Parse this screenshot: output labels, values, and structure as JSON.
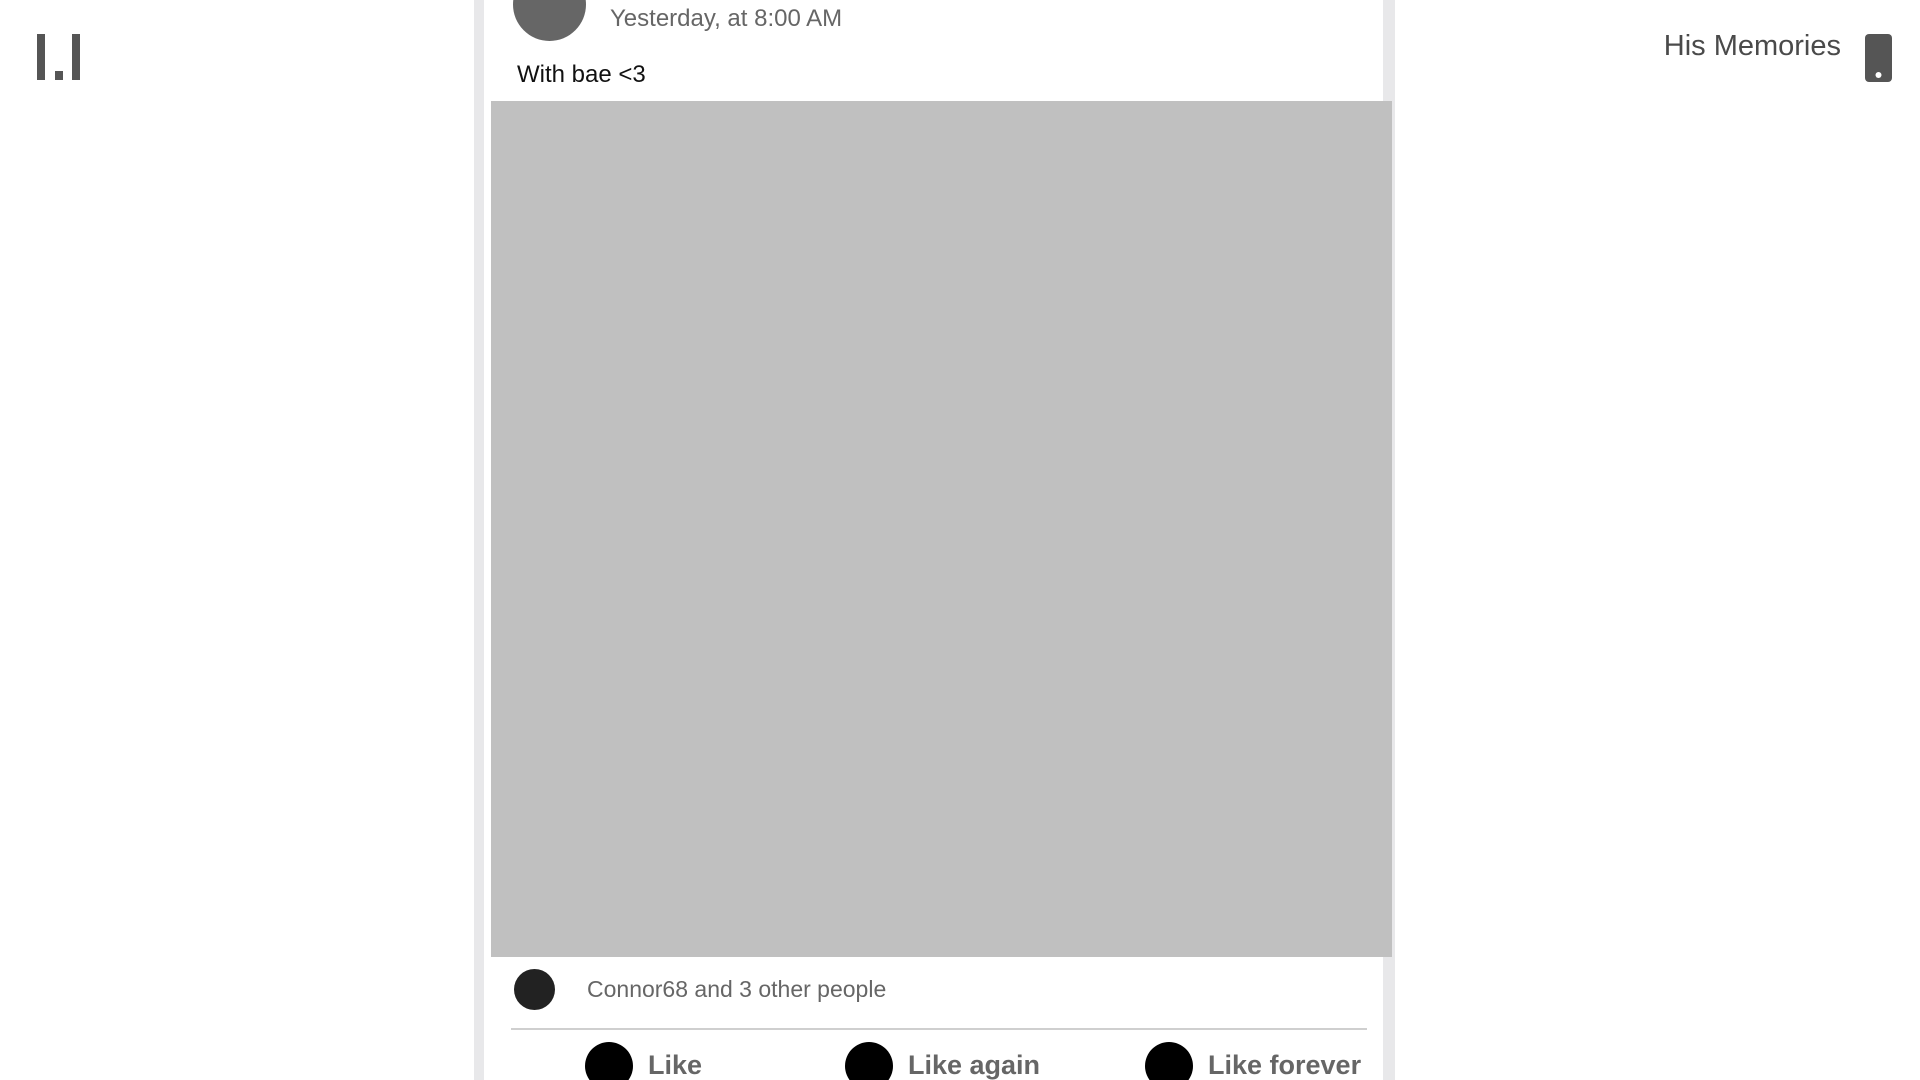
{
  "app": {
    "logo_icon": "bar-chart-logo-icon",
    "memories_title": "His Memories",
    "phone_icon": "phone-icon"
  },
  "post": {
    "author_avatar_icon": "avatar-icon",
    "timestamp": "Yesterday, at 8:00 AM",
    "caption": "With bae <3",
    "image_icon": "photo-placeholder"
  },
  "likes": {
    "liker_avatar_icon": "avatar-icon",
    "summary": "Connor68 and 3 other people"
  },
  "actions": [
    {
      "label": "Like",
      "icon": "like-icon"
    },
    {
      "label": "Like again",
      "icon": "like-again-icon"
    },
    {
      "label": "Like forever",
      "icon": "like-forever-icon"
    }
  ],
  "colors": {
    "background": "#ffffff",
    "frame": "#e8e8ea",
    "image_placeholder": "#c0c0c0",
    "muted_text": "#666666",
    "primary_text": "#111111",
    "action_icon": "#000000"
  }
}
